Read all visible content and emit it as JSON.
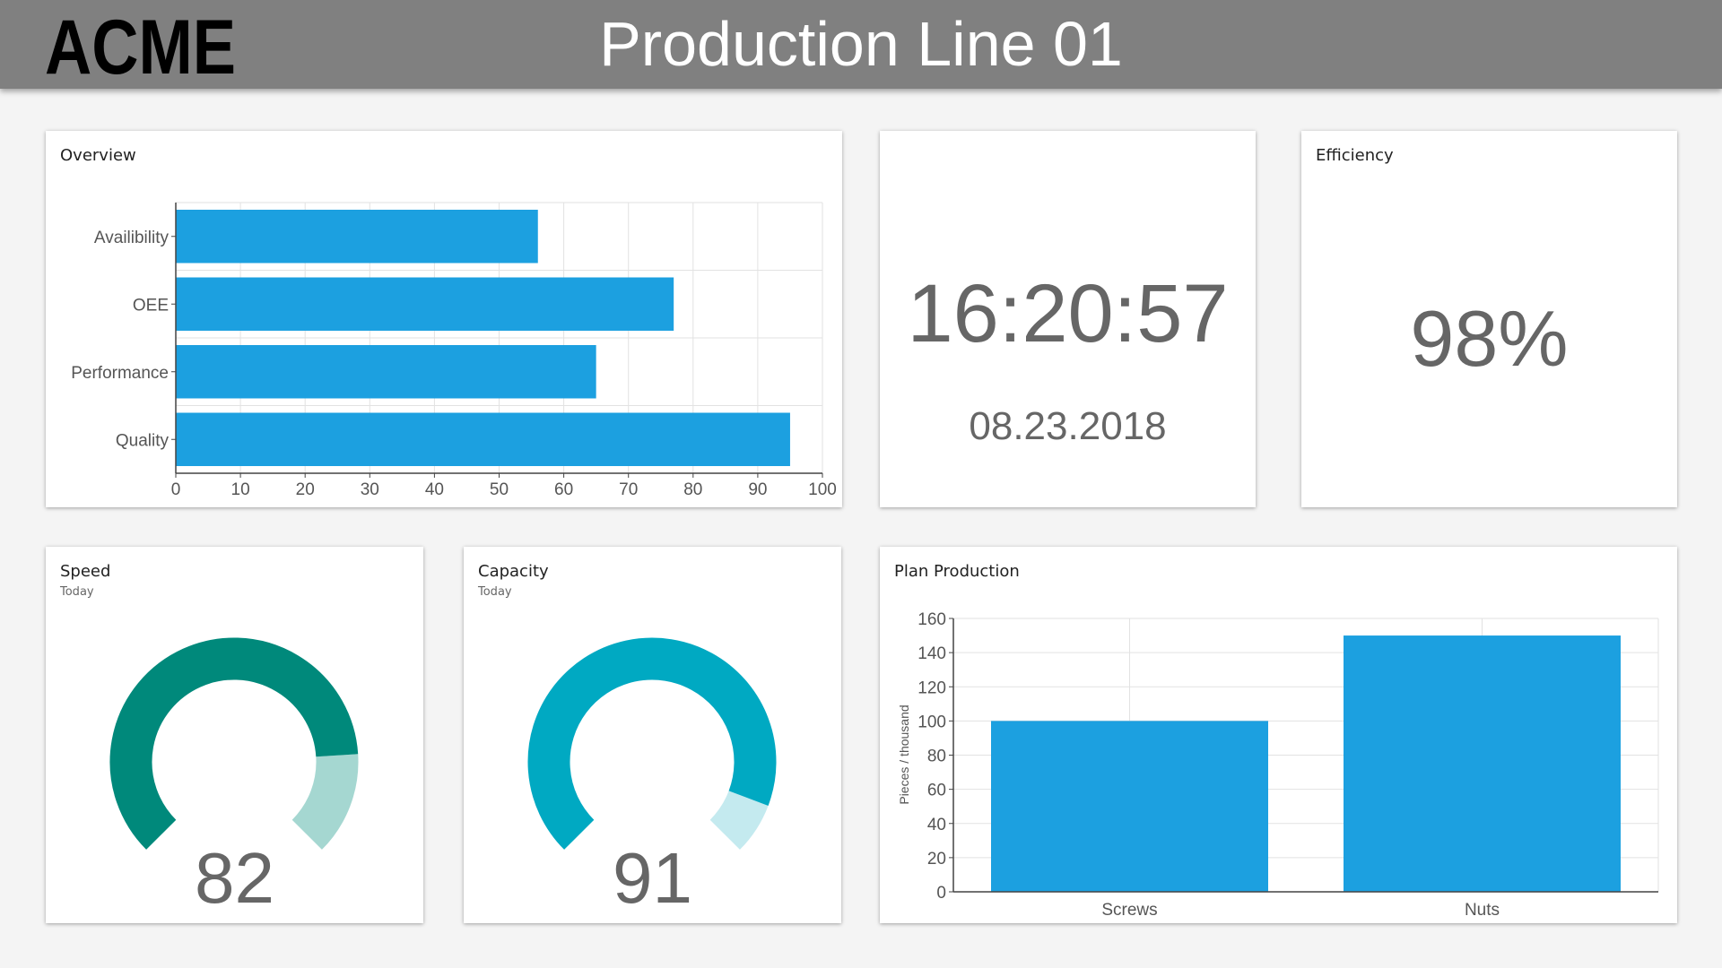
{
  "header": {
    "logo_text": "ACME",
    "title": "Production Line 01"
  },
  "overview": {
    "title": "Overview",
    "chart_data": {
      "type": "bar",
      "orientation": "horizontal",
      "categories": [
        "Availibility",
        "OEE",
        "Performance",
        "Quality"
      ],
      "values": [
        56,
        77,
        65,
        95
      ],
      "xlim": [
        0,
        100
      ],
      "xticks": [
        0,
        10,
        20,
        30,
        40,
        50,
        60,
        70,
        80,
        90,
        100
      ],
      "grid": true,
      "color": "#1ca0e0"
    }
  },
  "clock": {
    "time": "16:20:57",
    "date": "08.23.2018"
  },
  "efficiency": {
    "title": "Efficiency",
    "value": "98%"
  },
  "speed": {
    "title": "Speed",
    "subtitle": "Today",
    "value": "82",
    "level": 82,
    "color": "#00897b",
    "track_color": "#a5d7d1"
  },
  "capacity": {
    "title": "Capacity",
    "subtitle": "Today",
    "value": "91",
    "level": 91,
    "color": "#00a9c2",
    "track_color": "#c4eaef"
  },
  "plan": {
    "title": "Plan Production",
    "chart_data": {
      "type": "bar",
      "categories": [
        "Screws",
        "Nuts"
      ],
      "values": [
        100,
        150
      ],
      "ylabel": "Pieces / thousand",
      "ylim": [
        0,
        160
      ],
      "yticks": [
        0,
        20,
        40,
        60,
        80,
        100,
        120,
        140,
        160
      ],
      "grid": true,
      "color": "#1ca0e0"
    }
  }
}
